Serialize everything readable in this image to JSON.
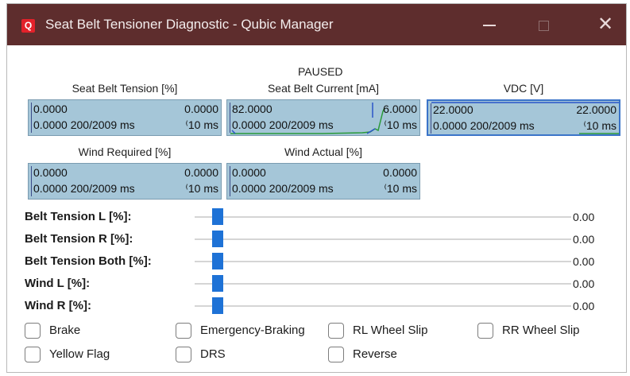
{
  "window": {
    "title": "Seat Belt Tensioner Diagnostic - Qubic Manager",
    "app_icon_glyph": "Q",
    "minimize_label": "",
    "maximize_label": "",
    "close_label": "✕",
    "titlebar_color": "#5e2d2d",
    "app_icon_color": "#e3212a"
  },
  "status": "PAUSED",
  "graphs": [
    {
      "label": "Seat Belt Tension [%]",
      "top_left": "0.0000",
      "top_right": "0.0000",
      "bottom_left": "0.0000 200/2009 ms",
      "bottom_right": "⁽10 ms"
    },
    {
      "label": "Seat Belt Current [mA]",
      "top_left": "82.0000",
      "top_right": "6.0000",
      "bottom_left": "0.0000 200/2009 ms",
      "bottom_right": "⁽10 ms"
    },
    {
      "label": "VDC [V]",
      "top_left": "22.0000",
      "top_right": "22.0000",
      "bottom_left": "0.0000 200/2009 ms",
      "bottom_right": "⁽10 ms"
    },
    {
      "label": "Wind Required [%]",
      "top_left": "0.0000",
      "top_right": "0.0000",
      "bottom_left": "0.0000 200/2009 ms",
      "bottom_right": "⁽10 ms"
    },
    {
      "label": "Wind Actual [%]",
      "top_left": "0.0000",
      "top_right": "0.0000",
      "bottom_left": "0.0000 200/2009 ms",
      "bottom_right": "⁽10 ms"
    }
  ],
  "sliders": [
    {
      "label": "Belt Tension L [%]:",
      "value": "0.00",
      "level": 0
    },
    {
      "label": "Belt Tension R [%]:",
      "value": "0.00",
      "level": 0
    },
    {
      "label": "Belt Tension Both [%]:",
      "value": "0.00",
      "level": 0
    },
    {
      "label": "Wind L [%]:",
      "value": "0.00",
      "level": 0
    },
    {
      "label": "Wind R [%]:",
      "value": "0.00",
      "level": 0
    }
  ],
  "checkboxes": [
    {
      "label": "Brake",
      "checked": false
    },
    {
      "label": "Emergency-Braking",
      "checked": false
    },
    {
      "label": "RL Wheel Slip",
      "checked": false
    },
    {
      "label": "RR Wheel Slip",
      "checked": false
    },
    {
      "label": "Yellow Flag",
      "checked": false
    },
    {
      "label": "DRS",
      "checked": false
    },
    {
      "label": "Reverse",
      "checked": false
    }
  ],
  "colors": {
    "graph_background": "#a5c6d8",
    "slider_thumb": "#1e72d6",
    "active_graph_border": "#3b74c9"
  }
}
